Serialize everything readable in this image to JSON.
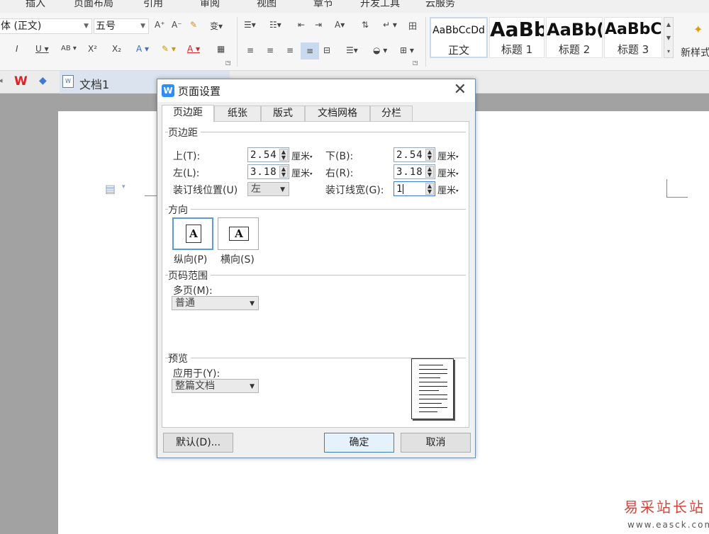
{
  "menu": [
    "插入",
    "页面布局",
    "引用",
    "审阅",
    "视图",
    "章节",
    "开发工具",
    "云服务"
  ],
  "ribbon": {
    "font_name": "体 (正文)",
    "font_size": "五号",
    "styles": [
      {
        "sample": "AaBbCcDd",
        "name": "正文"
      },
      {
        "sample": "AaBb",
        "name": "标题 1"
      },
      {
        "sample": "AaBb(",
        "name": "标题 2"
      },
      {
        "sample": "AaBbC",
        "name": "标题 3"
      }
    ],
    "new_style": "新样式"
  },
  "tabbar": {
    "doc_name": "文档1"
  },
  "dialog": {
    "title": "页面设置",
    "tabs": [
      "页边距",
      "纸张",
      "版式",
      "文档网格",
      "分栏"
    ],
    "margins": {
      "group": "页边距",
      "top_label": "上(T):",
      "top_value": "2.54",
      "bottom_label": "下(B):",
      "bottom_value": "2.54",
      "left_label": "左(L):",
      "left_value": "3.18",
      "right_label": "右(R):",
      "right_value": "3.18",
      "gutter_pos_label": "装订线位置(U)",
      "gutter_pos_value": "左",
      "gutter_width_label": "装订线宽(G):",
      "gutter_width_value": "1",
      "unit": "厘米"
    },
    "orientation": {
      "group": "方向",
      "portrait": "纵向(P)",
      "landscape": "横向(S)",
      "glyph": "A"
    },
    "page_range": {
      "group": "页码范围",
      "label": "多页(M):",
      "value": "普通"
    },
    "preview": {
      "group": "预览",
      "apply_label": "应用于(Y):",
      "apply_value": "整篇文档"
    },
    "buttons": {
      "default": "默认(D)...",
      "ok": "确定",
      "cancel": "取消"
    }
  },
  "watermark": {
    "text": "易采站长站",
    "url": "www.easck.com"
  }
}
